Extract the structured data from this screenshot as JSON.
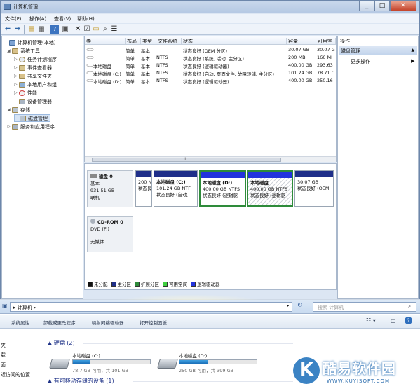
{
  "window": {
    "title": "计算机管理"
  },
  "window_buttons": {
    "minimize": "_",
    "maximize": "□",
    "close": "✕"
  },
  "menu": [
    "文件(F)",
    "操作(A)",
    "查看(V)",
    "帮助(H)"
  ],
  "toolbar_icons": [
    "back-arrow-icon",
    "forward-arrow-icon",
    "up-folder-icon",
    "show-hide-tree-icon",
    "help-icon",
    "properties-icon",
    "delete-icon",
    "checklist-icon",
    "open-folder-icon",
    "search-icon",
    "list-icon"
  ],
  "tree": [
    {
      "label": "计算机管理(本地)",
      "level": 0
    },
    {
      "label": "系统工具",
      "level": 1
    },
    {
      "label": "任务计划程序",
      "level": 2
    },
    {
      "label": "事件查看器",
      "level": 2
    },
    {
      "label": "共享文件夹",
      "level": 2
    },
    {
      "label": "本地用户和组",
      "level": 2
    },
    {
      "label": "性能",
      "level": 2
    },
    {
      "label": "设备管理器",
      "level": 2
    },
    {
      "label": "存储",
      "level": 1
    },
    {
      "label": "磁盘管理",
      "level": 2
    },
    {
      "label": "服务和应用程序",
      "level": 1
    }
  ],
  "volume_columns": [
    "卷",
    "布局",
    "类型",
    "文件系统",
    "状态",
    "容量",
    "可用空"
  ],
  "volumes": [
    {
      "name": "",
      "layout": "简单",
      "type": "基本",
      "fs": "",
      "status": "状态良好 (OEM 分区)",
      "capacity": "30.07 GB",
      "free": "30.07 G"
    },
    {
      "name": "",
      "layout": "简单",
      "type": "基本",
      "fs": "NTFS",
      "status": "状态良好 (系统, 活动, 主分区)",
      "capacity": "200 MB",
      "free": "166 MI"
    },
    {
      "name": "本地磁盘",
      "layout": "简单",
      "type": "基本",
      "fs": "NTFS",
      "status": "状态良好 (逻辑驱动器)",
      "capacity": "400.00 GB",
      "free": "293.63"
    },
    {
      "name": "本地磁盘 (C:)",
      "layout": "简单",
      "type": "基本",
      "fs": "NTFS",
      "status": "状态良好 (启动, 页面文件, 故障转储, 主分区)",
      "capacity": "101.24 GB",
      "free": "78.71 C"
    },
    {
      "name": "本地磁盘 (D:)",
      "layout": "简单",
      "type": "基本",
      "fs": "NTFS",
      "status": "状态良好 (逻辑驱动器)",
      "capacity": "400.00 GB",
      "free": "250.16"
    }
  ],
  "scrollbar_label": "III",
  "disk0": {
    "name": "磁盘 0",
    "type": "基本",
    "size": "931.51 GB",
    "status": "联机"
  },
  "partitions": [
    {
      "title": "",
      "line1": "200 N",
      "line2": "状态良"
    },
    {
      "title": "本地磁盘 (C:)",
      "line1": "101.24 GB NTF",
      "line2": "状态良好 (启动,"
    },
    {
      "title": "本地磁盘 (D:)",
      "line1": "400.00 GB NTFS",
      "line2": "状态良好 (逻辑驱"
    },
    {
      "title": "本地磁盘",
      "line1": "400.00 GB NTFS",
      "line2": "状态良好 (逻辑驱"
    },
    {
      "title": "",
      "line1": "30.07 GB",
      "line2": "状态良好 (OEM"
    }
  ],
  "cdrom": {
    "name": "CD-ROM 0",
    "drive": "DVD (F:)",
    "media": "无媒体"
  },
  "legend": [
    {
      "label": "未分配",
      "color": "#111111"
    },
    {
      "label": "主分区",
      "color": "#1f2f8a"
    },
    {
      "label": "扩展分区",
      "color": "#2e8b3a"
    },
    {
      "label": "可用空间",
      "color": "#3fcf3f"
    },
    {
      "label": "逻辑驱动器",
      "color": "#2233dd"
    }
  ],
  "actions": {
    "title": "操作",
    "section": "磁盘管理",
    "more": "更多操作"
  },
  "explorer": {
    "address": "▸ 计算机 ▸",
    "search_placeholder": "搜索 计算机",
    "commands": [
      "系统属性",
      "卸载或更改程序",
      "映射网络驱动器",
      "打开控制面板"
    ],
    "nav": [
      "夹",
      "载",
      "面",
      "近访问的位置"
    ],
    "group_hdd": "硬盘 (2)",
    "group_removable": "有可移动存储的设备 (1)",
    "drives": [
      {
        "name": "本地磁盘 (C:)",
        "free_text": "78.7 GB 可用，共 101 GB",
        "used_fraction": 0.22
      },
      {
        "name": "本地磁盘 (D:)",
        "free_text": "250 GB 可用，共 399 GB",
        "used_fraction": 0.37
      }
    ]
  },
  "watermark": {
    "letter": "K",
    "name": "酷易软件园",
    "url": "WWW.KUYISOFT.COM"
  }
}
